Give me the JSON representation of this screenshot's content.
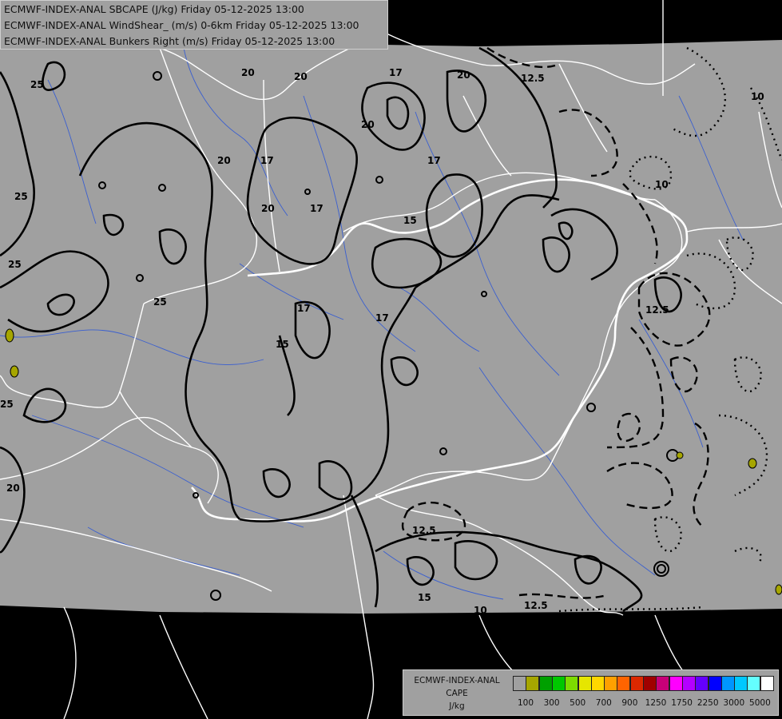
{
  "header": {
    "line1": "ECMWF-INDEX-ANAL SBCAPE (J/kg) Friday 05-12-2025 13:00",
    "line2": "ECMWF-INDEX-ANAL WindShear_ (m/s) 0-6km Friday 05-12-2025 13:00",
    "line3": "ECMWF-INDEX-ANAL Bunkers Right (m/s) Friday 05-12-2025 13:00"
  },
  "legend": {
    "title1": "ECMWF-INDEX-ANAL",
    "title2": "CAPE",
    "title3": "J/kg",
    "colors": [
      "#a0a0a0",
      "#a6a600",
      "#00a000",
      "#00c800",
      "#7ddc00",
      "#e6e600",
      "#ffd700",
      "#ffa000",
      "#ff6400",
      "#dc2800",
      "#a00000",
      "#c80078",
      "#ff00ff",
      "#b400ff",
      "#6400ff",
      "#0000ff",
      "#0096ff",
      "#00c8ff",
      "#64ffff",
      "#ffffff"
    ],
    "labels": [
      "100",
      "300",
      "500",
      "700",
      "900",
      "1250",
      "1750",
      "2250",
      "3000",
      "5000"
    ]
  },
  "contour_labels": {
    "shear": [
      "25",
      "25",
      "20",
      "20",
      "20",
      "17",
      "17",
      "17",
      "17",
      "17",
      "15",
      "15",
      "15",
      "20",
      "20",
      "17",
      "25",
      "25",
      "25",
      "20",
      "20"
    ],
    "bunkers": [
      "12.5",
      "10",
      "10",
      "12.5",
      "12.5",
      "12.5",
      "10"
    ]
  },
  "colors": {
    "background": "#000000",
    "map_fill": "#a0a0a0",
    "borders": "#ffffff",
    "rivers": "#3a5fd0",
    "contours": "#000000"
  }
}
